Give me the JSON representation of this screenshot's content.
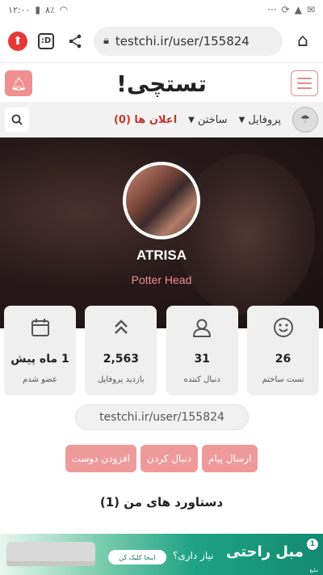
{
  "status_bar": {
    "time": "۱۲:۰۰",
    "battery": "۸٪",
    "left_icons": [
      "wifi-icon",
      "signal-icon",
      "battery-icon"
    ],
    "right_icons": [
      "warning-icon",
      "alert-icon",
      "sync-icon",
      "more-icon"
    ]
  },
  "browser": {
    "url": "testchi.ir/user/155824",
    "tab_label": ":D"
  },
  "site": {
    "logo": "تستچی!"
  },
  "nav": {
    "profile_label": "پروفایل",
    "build_label": "ساختن",
    "notifications_label": "اعلان ها (0)"
  },
  "profile": {
    "username": "ATRISA",
    "tagline": "Potter Head"
  },
  "stats": [
    {
      "icon": "smiley-icon",
      "value": "26",
      "label": "تست ساختم"
    },
    {
      "icon": "user-icon",
      "value": "31",
      "label": "دنبال کننده"
    },
    {
      "icon": "double-chevron-up-icon",
      "value": "2,563",
      "label": "بازدید پروفایل"
    },
    {
      "icon": "calendar-icon",
      "value": "1 ماه پیش",
      "label": "عضو شدم"
    }
  ],
  "profile_url": "testchi.ir/user/155824",
  "actions": {
    "send_message": "ارسال پیام",
    "follow": "دنبال کردن",
    "add_friend": "افزودن دوست"
  },
  "achievements_title": "دستاورد های من (1)",
  "ad": {
    "title": "مبل راحتی",
    "subtitle": "نیاز داری؟",
    "cta": "اینجا کلیک کن",
    "badge": "1",
    "note": "تبلیغ"
  },
  "colors": {
    "accent": "#ef9a9a",
    "notification_red": "#c0392b",
    "tagline": "#f08c8c",
    "ad_green": "#1ea383"
  }
}
